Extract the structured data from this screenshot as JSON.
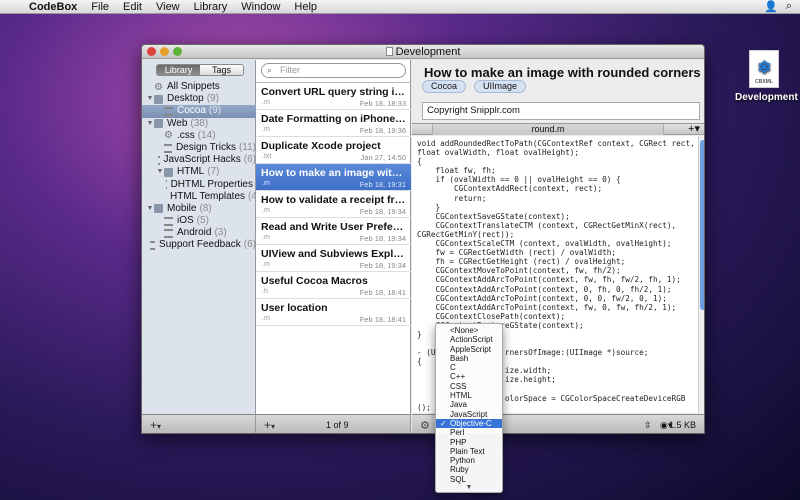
{
  "menubar": {
    "app": "CodeBox",
    "items": [
      "File",
      "Edit",
      "View",
      "Library",
      "Window",
      "Help"
    ]
  },
  "desktop_icon": {
    "label": "Development",
    "ext": "CBXML"
  },
  "window": {
    "title": "Development"
  },
  "library": {
    "seg_library": "Library",
    "seg_tags": "Tags",
    "tree": [
      {
        "label": "All Snippets",
        "count": "",
        "icon": "gear",
        "depth": 0,
        "tri": ""
      },
      {
        "label": "Desktop",
        "count": "(9)",
        "icon": "folder",
        "depth": 0,
        "tri": "▼"
      },
      {
        "label": "Cocoa",
        "count": "(9)",
        "icon": "list",
        "depth": 1,
        "tri": "",
        "selected": true
      },
      {
        "label": "Web",
        "count": "(38)",
        "icon": "folder",
        "depth": 0,
        "tri": "▼"
      },
      {
        "label": ".css",
        "count": "(14)",
        "icon": "gear",
        "depth": 1,
        "tri": ""
      },
      {
        "label": "Design Tricks",
        "count": "(11)",
        "icon": "list",
        "depth": 1,
        "tri": ""
      },
      {
        "label": "JavaScript Hacks",
        "count": "(6)",
        "icon": "list",
        "depth": 1,
        "tri": ""
      },
      {
        "label": "HTML",
        "count": "(7)",
        "icon": "folder",
        "depth": 1,
        "tri": "▼"
      },
      {
        "label": "DHTML Properties",
        "count": "",
        "icon": "list",
        "depth": 2,
        "tri": ""
      },
      {
        "label": "HTML Templates",
        "count": "(4)",
        "icon": "list",
        "depth": 2,
        "tri": ""
      },
      {
        "label": "Mobile",
        "count": "(8)",
        "icon": "folder",
        "depth": 0,
        "tri": "▼"
      },
      {
        "label": "iOS",
        "count": "(5)",
        "icon": "list",
        "depth": 1,
        "tri": ""
      },
      {
        "label": "Android",
        "count": "(3)",
        "icon": "list",
        "depth": 1,
        "tri": ""
      },
      {
        "label": "Support Feedback",
        "count": "(6)",
        "icon": "list",
        "depth": 0,
        "tri": ""
      }
    ]
  },
  "search": {
    "placeholder": "Filter"
  },
  "snippets": [
    {
      "title": "Convert URL query string into NSDictionary",
      "ext": ".m",
      "date": "Feb 18, 18:33"
    },
    {
      "title": "Date Formatting on iPhone and Cocoa",
      "ext": ".m",
      "date": "Feb 18, 19:36"
    },
    {
      "title": "Duplicate Xcode project",
      "ext": ".txt",
      "date": "Jan 27, 14:50"
    },
    {
      "title": "How to make an image with rounded corners",
      "ext": ".m",
      "date": "Feb 18, 19:31",
      "selected": true
    },
    {
      "title": "How to validate a receipt from the Mac App Store",
      "ext": ".m",
      "date": "Feb 18, 19:34"
    },
    {
      "title": "Read and Write User Preferences",
      "ext": ".m",
      "date": "Feb 18, 19:34"
    },
    {
      "title": "UIView and Subviews Exploded",
      "ext": ".m",
      "date": "Feb 18, 19:34"
    },
    {
      "title": "Useful Cocoa Macros",
      "ext": ".h",
      "date": "Feb 18, 18:41"
    },
    {
      "title": "User location",
      "ext": ".m",
      "date": "Feb 18, 18:41"
    }
  ],
  "list_footer": {
    "count": "1 of 9"
  },
  "editor": {
    "title": "How to make an image with rounded corners",
    "tags": [
      "Cocoa",
      "UIImage"
    ],
    "copyright": "Copyright Snipplr.com",
    "tab": "round.m",
    "tab_plus": "+",
    "size": "1.5 KB"
  },
  "code_lines": [
    "void addRoundedRectToPath(CGContextRef context, CGRect rect,",
    "float ovalWidth, float ovalHeight);",
    "{",
    "    float fw, fh;",
    "    if (ovalWidth == 0 || ovalHeight == 0) {",
    "        CGContextAddRect(context, rect);",
    "        return;",
    "    }",
    "    CGContextSaveGState(context);",
    "    CGContextTranslateCTM (context, CGRectGetMinX(rect),",
    "CGRectGetMinY(rect));",
    "    CGContextScaleCTM (context, ovalWidth, ovalHeight);",
    "    fw = CGRectGetWidth (rect) / ovalWidth;",
    "    fh = CGRectGetHeight (rect) / ovalHeight;",
    "    CGContextMoveToPoint(context, fw, fh/2);",
    "    CGContextAddArcToPoint(context, fw, fh, fw/2, fh, 1);",
    "    CGContextAddArcToPoint(context, 0, fh, 0, fh/2, 1);",
    "    CGContextAddArcToPoint(context, 0, 0, fw/2, 0, 1);",
    "    CGContextAddArcToPoint(context, fw, 0, fw, fh/2, 1);",
    "    CGContextClosePath(context);",
    "    CGContextRestoreGState(context);",
    "}",
    "",
    "- (UI              rnersOfImage:(UIImage *)source;",
    "{",
    "                   ize.width;",
    "                   ize.height;",
    "",
    "                   olorSpace = CGColorSpaceCreateDeviceRGB",
    "();",
    "                   text = CGBitmapContextCreate(NULL, w, h,",
    "8, 4                , kCGImageAlphaPremultipliedFirst);",
    "",
    "                   th(context);"
  ],
  "language_menu": {
    "options": [
      "<None>",
      "ActionScript",
      "AppleScript",
      "Bash",
      "C",
      "C++",
      "CSS",
      "HTML",
      "Java",
      "JavaScript",
      "Objective-C",
      "Perl",
      "PHP",
      "Plain Text",
      "Python",
      "Ruby",
      "SQL"
    ],
    "selected": "Objective-C"
  },
  "colors": {
    "selection": "#3e70c8",
    "accent": "#3874d8"
  }
}
